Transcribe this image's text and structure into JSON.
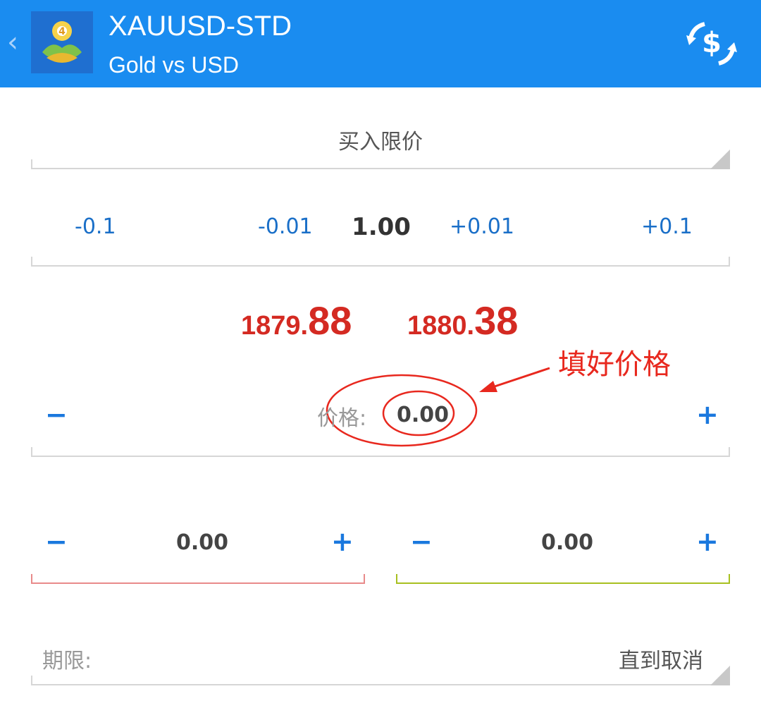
{
  "header": {
    "title": "XAUUSD-STD",
    "subtitle": "Gold vs USD",
    "back_icon": "chevron-left-icon",
    "app_icon": "metatrader-logo-icon",
    "trade_icon": "dollar-exchange-icon",
    "color": "#1a8cf0"
  },
  "order_type": {
    "label": "买入限价"
  },
  "volume": {
    "dec_large": "-0.1",
    "dec_small": "-0.01",
    "value": "1.00",
    "inc_small": "+0.01",
    "inc_large": "+0.1"
  },
  "quotes": {
    "bid_prefix": "1879.",
    "bid_big": "88",
    "ask_prefix": "1880.",
    "ask_big": "38",
    "color": "#d42a22"
  },
  "price": {
    "minus": "−",
    "label": "价格:",
    "value": "0.00",
    "plus": "+"
  },
  "stop_loss": {
    "minus": "−",
    "value": "0.00",
    "plus": "+",
    "line_color": "#e88a8a"
  },
  "take_profit": {
    "minus": "−",
    "value": "0.00",
    "plus": "+",
    "line_color": "#a8c020"
  },
  "annotation": {
    "text": "填好价格",
    "color": "#e8281e"
  },
  "expiration": {
    "label": "期限:",
    "value": "直到取消"
  }
}
